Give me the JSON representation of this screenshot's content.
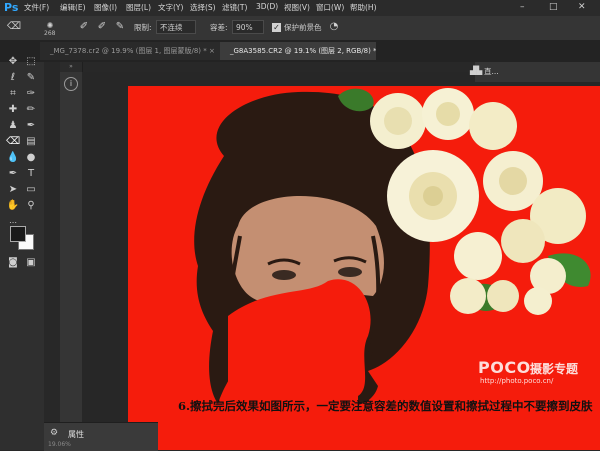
{
  "app": {
    "logo": "Ps"
  },
  "menu": [
    "文件(F)",
    "编辑(E)",
    "图像(I)",
    "图层(L)",
    "文字(Y)",
    "选择(S)",
    "滤镜(T)",
    "3D(D)",
    "视图(V)",
    "窗口(W)",
    "帮助(H)"
  ],
  "window_controls": {
    "minimize": "–",
    "maximize": "□",
    "close": "✕"
  },
  "options": {
    "brush_size": "268",
    "limits_label": "限制:",
    "limits_value": "不连续",
    "tolerance_label": "容差:",
    "tolerance_value": "90%",
    "protect_label": "保护前景色"
  },
  "tabs": [
    {
      "label": "_MG_7378.cr2 @ 19.9% (图层 1, 图层蒙版/8) *",
      "close": "×"
    },
    {
      "label": "_G8A3585.CR2 @ 19.1% (图层 2, RGB/8) *",
      "close": "×"
    }
  ],
  "right_panel": {
    "label": "直..."
  },
  "caption": "6.擦拭完后效果如图所示，一定要注意容差的数值设置和擦拭过程中不要擦到皮肤",
  "watermark": {
    "brand": "POCO",
    "brand_cn": "摄影专题",
    "url": "http://photo.poco.cn/"
  },
  "properties_panel": {
    "label": "属性"
  },
  "status_text": "19.06%",
  "colors": {
    "canvas_bg": "#f51c0c",
    "ui_bg": "#282828",
    "accent": "#31a8ff"
  },
  "icons": {
    "info": "i"
  }
}
